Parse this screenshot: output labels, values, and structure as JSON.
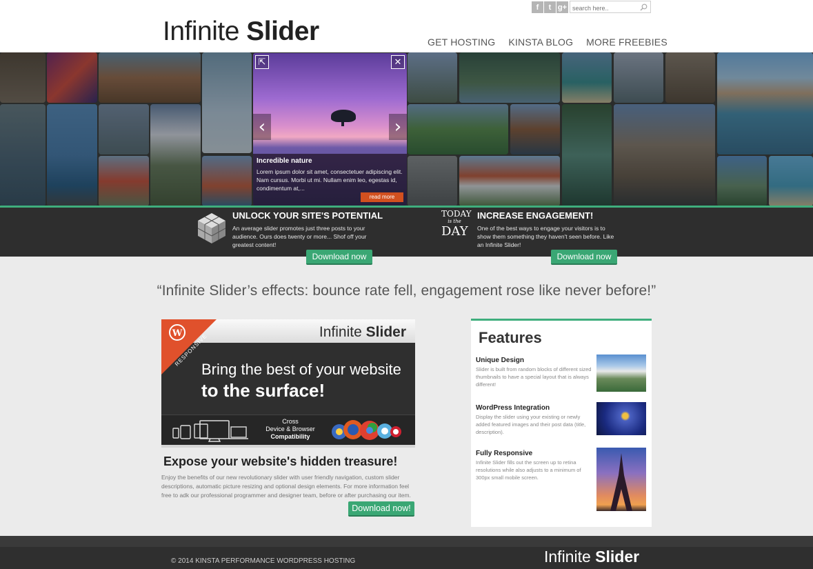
{
  "header": {
    "logo_light": "Infinite",
    "logo_bold": "Slider",
    "social": [
      "f",
      "t",
      "g+"
    ],
    "search_placeholder": "search here..",
    "nav": [
      "GET HOSTING",
      "KINSTA BLOG",
      "MORE FREEBIES"
    ]
  },
  "slider": {
    "caption_title": "Incredible nature",
    "caption_text": "Lorem ipsum dolor sit amet, consectetuer adipiscing elit. Nam cursus. Morbi ut mi. Nullam enim leo, egestas id, condimentum at,...",
    "read_more": "read more"
  },
  "band": {
    "left": {
      "title": "UNLOCK YOUR SITE'S POTENTIAL",
      "text": "An average slider promotes just three posts to your audience. Ours does twenty or more... Shof off your greatest content!",
      "button": "Download now"
    },
    "right": {
      "icon_text_1": "TODAY",
      "icon_text_2": "is the",
      "icon_text_3": "DAY",
      "title": "INCREASE ENGAGEMENT!",
      "text": "One of the best ways to engage your visitors is to show them something they haven't seen before. Like an Infinite Slider!",
      "button": "Download now"
    }
  },
  "quote": "“Infinite Slider’s effects: bounce rate fell, engagement rose like never before!”",
  "banner": {
    "title_light": "Infinite",
    "title_bold": "Slider",
    "ribbon": "RESPONSIVE",
    "line1": "Bring the best of your website",
    "line2": "to the surface!",
    "cross_1": "Cross",
    "cross_2": "Device & Browser",
    "cross_3": "Compatibility"
  },
  "expose": {
    "title": "Expose your website's hidden treasure!",
    "text": "Enjoy the benefits of our new revolutionary slider with user friendly navigation, custom slider descriptions, automatic picture resizing and optional design elements. For more information feel free to adk our professional programmer and designer team, before or after purchasing our item.",
    "button": "Download now!"
  },
  "features": {
    "title": "Features",
    "items": [
      {
        "title": "Unique Design",
        "text": "Slider is built from random blocks of different sized thumbnails to have a special layout that is always different!"
      },
      {
        "title": "WordPress Integration",
        "text": "Display the slider using your existing or newly added featured images and their post data (title, description)."
      },
      {
        "title": "Fully Responsive",
        "text": "Infinite Slider fills out the screen up to retina resolutions while also adjusts to a minimum of 300px small mobile screen."
      }
    ]
  },
  "footer": {
    "copy_prefix": "© 2014",
    "copy_link": "KINSTA PERFORMANCE WORDPRESS HOSTING",
    "logo_light": "Infinite",
    "logo_bold": "Slider"
  },
  "colors": {
    "accent_green": "#3fae7d",
    "button_green": "#3aa774",
    "read_more_orange": "#d2501f",
    "dark_band": "#2e2e2e"
  }
}
